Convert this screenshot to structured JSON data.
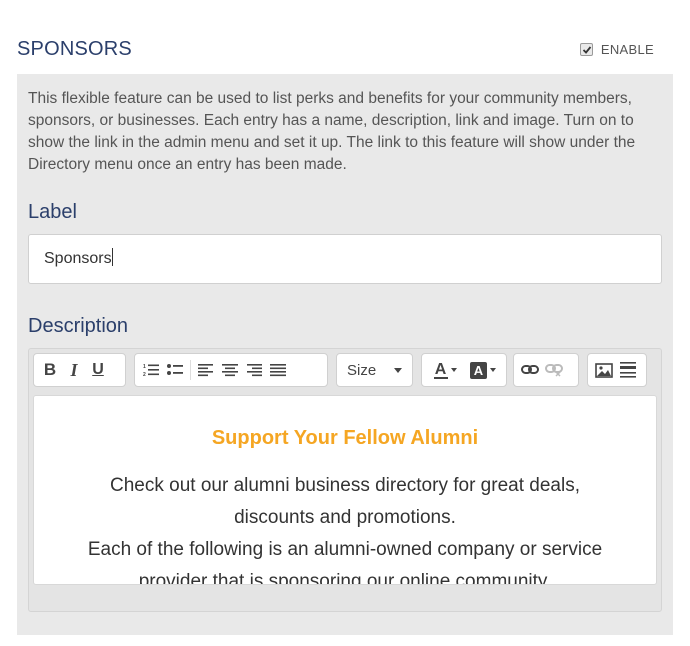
{
  "header": {
    "title": "SPONSORS",
    "enable_label": "ENABLE",
    "enabled": true
  },
  "panel": {
    "description": "This flexible feature can be used to list perks and benefits for your community members, sponsors, or businesses. Each entry has a name, description, link and image. Turn on to show the link in the admin menu and set it up. The link to this feature will show under the Directory menu once an entry has been made.",
    "label_heading": "Label",
    "label_value": "Sponsors",
    "description_heading": "Description"
  },
  "toolbar": {
    "bold": "B",
    "italic": "I",
    "underline": "U",
    "size_label": "Size",
    "font_color": "A",
    "bg_color": "A",
    "icons": [
      "bold-icon",
      "italic-icon",
      "underline-icon",
      "ordered-list-icon",
      "unordered-list-icon",
      "align-left-icon",
      "align-center-icon",
      "align-right-icon",
      "align-justify-icon",
      "font-size-dropdown",
      "font-color-icon",
      "background-color-icon",
      "link-icon",
      "unlink-icon",
      "image-icon",
      "horizontal-rule-icon"
    ]
  },
  "editor_content": {
    "title": "Support Your Fellow Alumni",
    "para1_line1": "Check out our alumni business directory for great deals,",
    "para1_line2": "discounts and promotions.",
    "para2_line1": "Each of the following is an alumni-owned company or service",
    "para2_line2": "provider that is sponsoring our online community.",
    "title_color": "#f5a623"
  },
  "colors": {
    "heading": "#2b3f6b",
    "panel_bg": "#e9e9e9"
  }
}
